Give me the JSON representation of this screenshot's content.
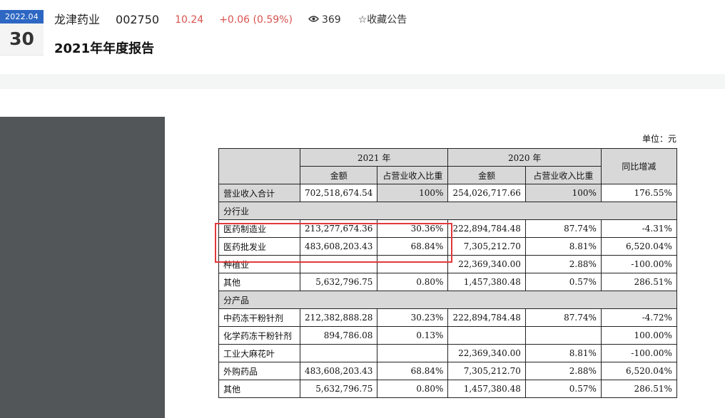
{
  "header": {
    "date_month": "2022.04",
    "date_day": "30",
    "stock_name": "龙津药业",
    "stock_code": "002750",
    "price": "10.24",
    "change": "+0.06 (0.59%)",
    "views": "369",
    "favorite_label": "☆收藏公告",
    "title": "2021年年度报告"
  },
  "colors": {
    "accent": "#2d67c3",
    "up": "#d9534f",
    "highlight": "#e3383b",
    "sidebar": "#535659"
  },
  "icons": {
    "views": "eye-icon",
    "favorite": "star-icon"
  },
  "doc": {
    "unit": "单位：元",
    "head": {
      "y2021": "2021 年",
      "y2020": "2020 年",
      "yoy": "同比增减",
      "amount": "金额",
      "ratio": "占营业收入比重"
    },
    "total": {
      "label": "营业收入合计",
      "a21": "702,518,674.54",
      "p21": "100%",
      "a20": "254,026,717.66",
      "p20": "100%",
      "yoy": "176.55%"
    },
    "section_industry": "分行业",
    "industry_rows": [
      {
        "label": "医药制造业",
        "a21": "213,277,674.36",
        "p21": "30.36%",
        "a20": "222,894,784.48",
        "p20": "87.74%",
        "yoy": "-4.31%"
      },
      {
        "label": "医药批发业",
        "a21": "483,608,203.43",
        "p21": "68.84%",
        "a20": "7,305,212.70",
        "p20": "8.81%",
        "yoy": "6,520.04%"
      },
      {
        "label": "种植业",
        "a21": "",
        "p21": "",
        "a20": "22,369,340.00",
        "p20": "2.88%",
        "yoy": "-100.00%"
      },
      {
        "label": "其他",
        "a21": "5,632,796.75",
        "p21": "0.80%",
        "a20": "1,457,380.48",
        "p20": "0.57%",
        "yoy": "286.51%"
      }
    ],
    "section_product": "分产品",
    "product_rows": [
      {
        "label": "中药冻干粉针剂",
        "a21": "212,382,888.28",
        "p21": "30.23%",
        "a20": "222,894,784.48",
        "p20": "87.74%",
        "yoy": "-4.72%"
      },
      {
        "label": "化学药冻干粉针剂",
        "a21": "894,786.08",
        "p21": "0.13%",
        "a20": "",
        "p20": "",
        "yoy": "100.00%"
      },
      {
        "label": "工业大麻花叶",
        "a21": "",
        "p21": "",
        "a20": "22,369,340.00",
        "p20": "8.81%",
        "yoy": "-100.00%"
      },
      {
        "label": "外购药品",
        "a21": "483,608,203.43",
        "p21": "68.84%",
        "a20": "7,305,212.70",
        "p20": "2.88%",
        "yoy": "6,520.04%"
      },
      {
        "label": "其他",
        "a21": "5,632,796.75",
        "p21": "0.80%",
        "a20": "1,457,380.48",
        "p20": "0.57%",
        "yoy": "286.51%"
      }
    ]
  }
}
